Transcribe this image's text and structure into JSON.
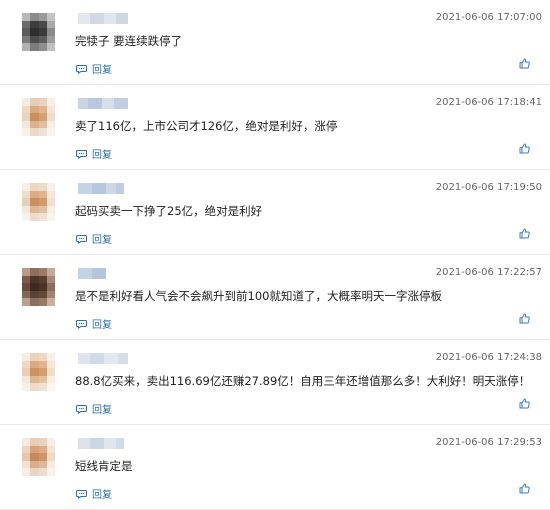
{
  "comments": [
    {
      "time": "2021-06-06 17:07:00",
      "text": "完犊子 要连续跌停了",
      "reply": "回复",
      "avatar": [
        "#b8b8b8",
        "#8c8c8c",
        "#9a9a9a",
        "#c4c4c4",
        "#6a6a6a",
        "#3d3d3d",
        "#4a4a4a",
        "#a8a8a8",
        "#5a5a5a",
        "#2e2e2e",
        "#3a3a3a",
        "#8a8a8a",
        "#7a7a7a",
        "#4d4d4d",
        "#5c5c5c",
        "#9c9c9c",
        "#b0b0b0",
        "#7c7c7c",
        "#8e8e8e",
        "#c0c0c0"
      ],
      "username_blocks": [
        "#e4e8ee",
        "#d2d9e4",
        "#e0e6ee",
        "#cfd7e3"
      ]
    },
    {
      "time": "2021-06-06 17:18:41",
      "text": "卖了116亿，上市公司才126亿，绝对是利好，涨停",
      "reply": "回复",
      "avatar": [
        "#f4ece4",
        "#e6cdb8",
        "#e9d2c0",
        "#f6efe8",
        "#efd9c4",
        "#d9ab7c",
        "#dfb58f",
        "#f2e4d6",
        "#ead2bb",
        "#c98f5c",
        "#d2a072",
        "#efdccb",
        "#f3e7dc",
        "#dcb28a",
        "#e2bf9c",
        "#f6eee6",
        "#f7f1ea",
        "#ecdac8",
        "#efe1d3",
        "#f8f3ee"
      ],
      "username_blocks": [
        "#c9d5e6",
        "#b9c8de",
        "#d6e0ec",
        "#c1cee2"
      ]
    },
    {
      "time": "2021-06-06 17:19:50",
      "text": "起码买卖一下挣了25亿，绝对是利好",
      "reply": "回复",
      "avatar": [
        "#f6eee6",
        "#ecd6c4",
        "#eed9c8",
        "#f7f0ea",
        "#f0dccb",
        "#d9ae87",
        "#ddb591",
        "#f3e6da",
        "#e9cfb8",
        "#c98f5e",
        "#d09b6c",
        "#efdfd0",
        "#f3e8de",
        "#ddb896",
        "#e1bf9f",
        "#f6efe8",
        "#f8f2ec",
        "#ecdccc",
        "#efe2d5",
        "#f9f4ef"
      ],
      "username_blocks": [
        "#c6d3e5",
        "#b7c7de",
        "#ccd8e8",
        "#bfcde2"
      ]
    },
    {
      "time": "2021-06-06 17:22:57",
      "text": "是不是利好看人气会不会飙升到前100就知道了，大概率明天一字涨停板",
      "reply": "回复",
      "avatar": [
        "#b89a86",
        "#8e6e5c",
        "#9c7a66",
        "#c4aa98",
        "#7a5a48",
        "#4e3428",
        "#5a3e30",
        "#a6887a",
        "#6a4c3c",
        "#3e2a20",
        "#4a3226",
        "#8c6e5e",
        "#846656",
        "#5a4234",
        "#66483a",
        "#a08474",
        "#b8a090",
        "#8a7060",
        "#987a6a",
        "#c6b0a2"
      ],
      "username_blocks": [
        "#c4d2e6",
        "#b4c5de"
      ]
    },
    {
      "time": "2021-06-06 17:24:38",
      "text": "88.8亿买来，卖出116.69亿还赚27.89亿！自用三年还增值那么多！大利好！明天涨停！",
      "reply": "回复",
      "avatar": [
        "#f6ece2",
        "#ecd2bc",
        "#efd8c4",
        "#f8f0e8",
        "#f0d9c4",
        "#dba97c",
        "#e0b48c",
        "#f4e4d4",
        "#eacdb2",
        "#cc9260",
        "#d49e70",
        "#f0dccb",
        "#f4e6d8",
        "#deb690",
        "#e3c09e",
        "#f7eee4",
        "#f8f1ea",
        "#eddaca",
        "#f0e2d4",
        "#faf5f0"
      ],
      "username_blocks": [
        "#dde4ee",
        "#d0dae8",
        "#e2e8f0",
        "#d4dde9"
      ]
    },
    {
      "time": "2021-06-06 17:29:53",
      "text": "短线肯定是",
      "reply": "回复",
      "avatar": [
        "#f4eae0",
        "#e8ccb6",
        "#ebd2be",
        "#f6eee6",
        "#edd4be",
        "#d6a276",
        "#dcac84",
        "#f2e2d2",
        "#e6c6aa",
        "#c68a58",
        "#ce966a",
        "#eed8c6",
        "#f2e2d4",
        "#d9ae88",
        "#dfb896",
        "#f5ebe0",
        "#f6eee6",
        "#ead4c2",
        "#edddce",
        "#f8f2ec"
      ],
      "username_blocks": [
        "#dbe2ec",
        "#ccd6e4",
        "#e0e6ee",
        "#d2dbe8"
      ]
    }
  ],
  "colors": {
    "link": "#2a6ebb",
    "time": "#666666",
    "text": "#222222",
    "divider": "#e8e8e8"
  }
}
